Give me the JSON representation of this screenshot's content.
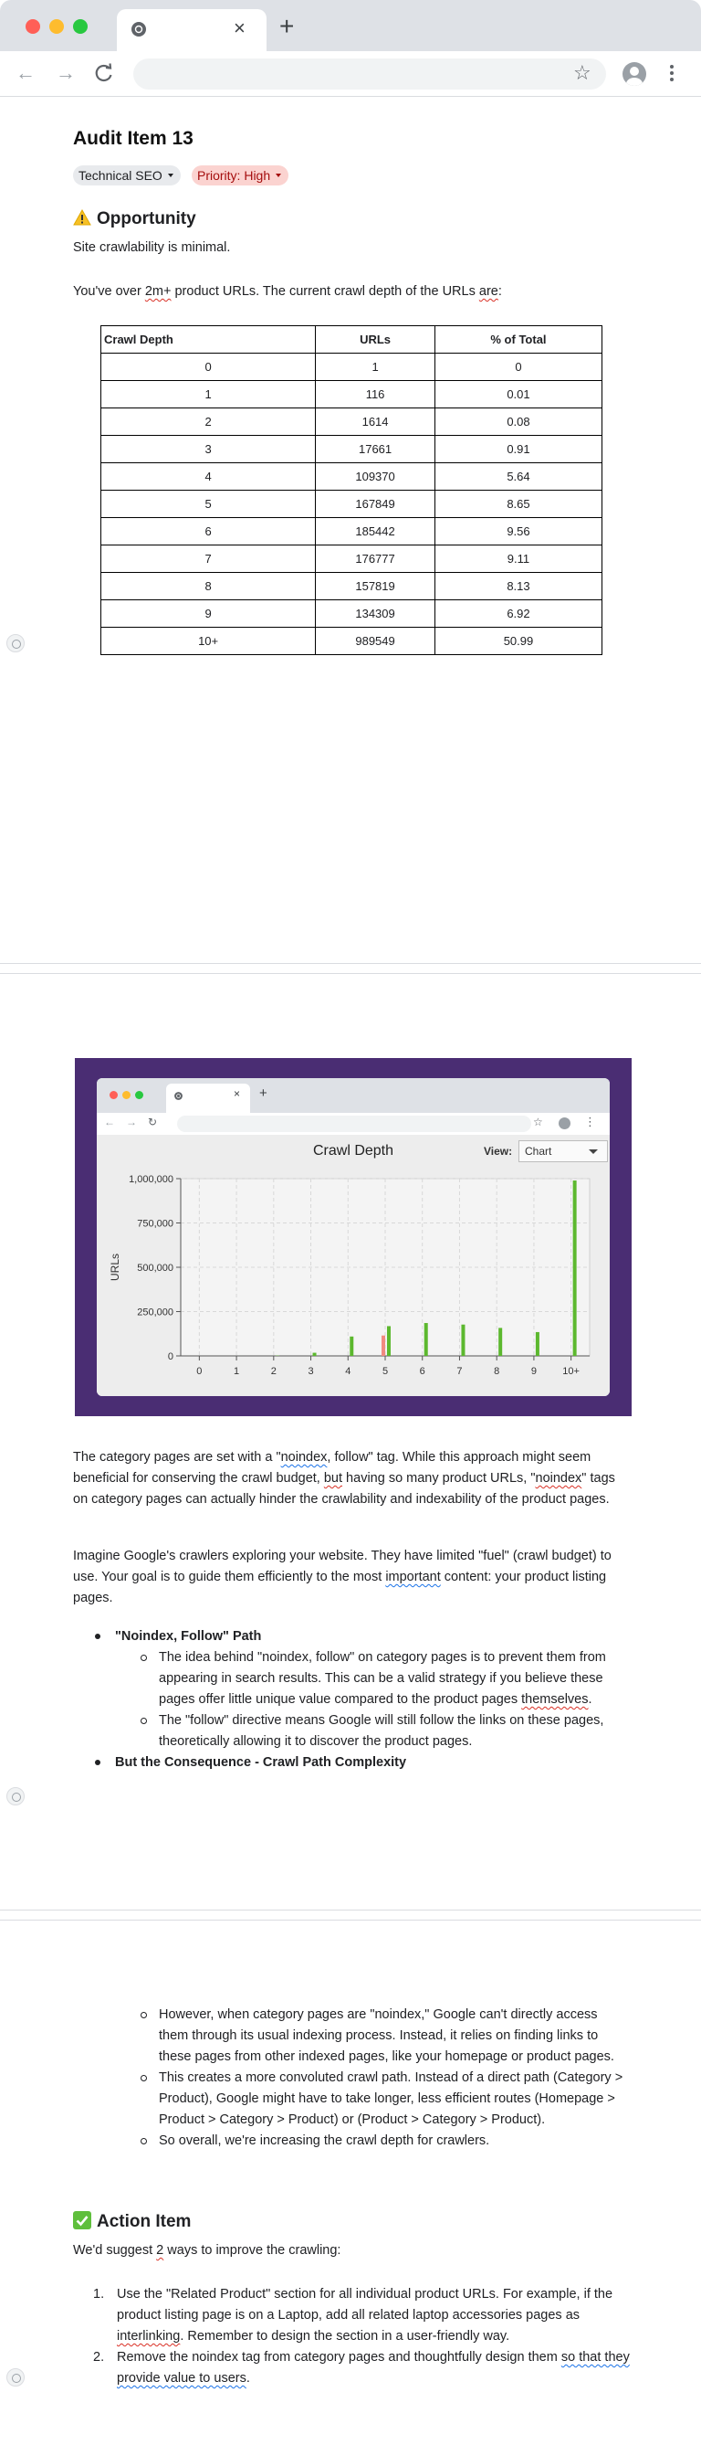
{
  "browser": {
    "tab_close": "×",
    "new_tab": "+",
    "address_value": ""
  },
  "doc": {
    "title": "Audit Item 13",
    "category_chip": "Technical SEO",
    "priority_chip": "Priority: High",
    "opportunity_heading": "Opportunity",
    "opportunity_text": "Site crawlability is minimal.",
    "intro_a": "You've over ",
    "intro_b": "2m+",
    "intro_c": "  product URLs. The current crawl depth of the URLs ",
    "intro_d": "are",
    "intro_e": ":"
  },
  "table": {
    "headers": [
      "Crawl Depth",
      "URLs",
      "% of Total"
    ],
    "rows": [
      [
        "0",
        "1",
        "0"
      ],
      [
        "1",
        "116",
        "0.01"
      ],
      [
        "2",
        "1614",
        "0.08"
      ],
      [
        "3",
        "17661",
        "0.91"
      ],
      [
        "4",
        "109370",
        "5.64"
      ],
      [
        "5",
        "167849",
        "8.65"
      ],
      [
        "6",
        "185442",
        "9.56"
      ],
      [
        "7",
        "176777",
        "9.11"
      ],
      [
        "8",
        "157819",
        "8.13"
      ],
      [
        "9",
        "134309",
        "6.92"
      ],
      [
        "10+",
        "989549",
        "50.99"
      ]
    ]
  },
  "screenshot": {
    "chart_title": "Crawl Depth",
    "view_label": "View:",
    "view_value": "Chart"
  },
  "chart_data": {
    "type": "bar",
    "title": "Crawl Depth",
    "xlabel": "",
    "ylabel": "URLs",
    "categories": [
      "0",
      "1",
      "2",
      "3",
      "4",
      "5",
      "6",
      "7",
      "8",
      "9",
      "10+"
    ],
    "yticks": [
      "0",
      "250,000",
      "500,000",
      "750,000",
      "1,000,000"
    ],
    "ylim": [
      0,
      1000000
    ],
    "grid": true,
    "series": [
      {
        "values": [
          1,
          116,
          1614,
          17661,
          109370,
          167849,
          185442,
          176777,
          157819,
          134309,
          989549
        ],
        "color": "#5cb82e"
      },
      {
        "values": [
          0,
          0,
          0,
          0,
          0,
          115000,
          0,
          0,
          0,
          0,
          0
        ],
        "color": "#f08a80"
      }
    ]
  },
  "body": {
    "p1_a": "The category pages are set with a \"",
    "p1_b": "noindex",
    "p1_c": ", follow\" tag. While this approach might seem beneficial for conserving the crawl budget, ",
    "p1_d": "but",
    "p1_e": " having so many product URLs, \"",
    "p1_f": "noindex",
    "p1_g": "\" tags on category pages can actually hinder the crawlability and indexability of the product pages.",
    "p2_a": "Imagine Google's crawlers exploring your website. They have limited \"fuel\" (crawl budget) to use. Your goal is to guide them efficiently to the most ",
    "p2_b": "important",
    "p2_c": " content: your product listing pages.",
    "b1_title": "\"Noindex, Follow\" Path",
    "b1_s1_a": "The idea behind \"noindex, follow\" on category pages is to prevent them from appearing in search results. This can be a valid strategy if you believe these pages offer little unique value compared to the product pages ",
    "b1_s1_b": "themselves",
    "b1_s1_c": ".",
    "b1_s2": "The \"follow\" directive means Google will still follow the links on these pages, theoretically allowing it to discover the product pages.",
    "b2_title": "But the Consequence - Crawl Path Complexity",
    "b2_s1": "However, when category pages are \"noindex,\" Google can't directly access them through its usual indexing process. Instead, it relies on finding links to these pages from other indexed pages, like your homepage or product pages.",
    "b2_s2": "This creates a more convoluted crawl path. Instead of a direct path (Category > Product), Google might have to take longer, less efficient routes (Homepage > Product > Category > Product) or (Product > Category > Product).",
    "b2_s3": "So overall, we're increasing the crawl depth for crawlers.",
    "action_heading": "Action Item",
    "action_intro_a": "We'd suggest ",
    "action_intro_b": "2",
    "action_intro_c": " ways to improve the crawling:",
    "ol1_num": "1.",
    "ol1_a": "Use the \"Related Product\" section for all individual product URLs. For example, if the product listing page is on a Laptop, add all related laptop accessories pages as ",
    "ol1_b": "interlinking",
    "ol1_c": ". Remember to design the section in a user-friendly way.",
    "ol2_num": "2.",
    "ol2_a": "Remove the noindex tag from category pages and thoughtfully design them ",
    "ol2_b": "so that they provide value to users",
    "ol2_c": "."
  }
}
